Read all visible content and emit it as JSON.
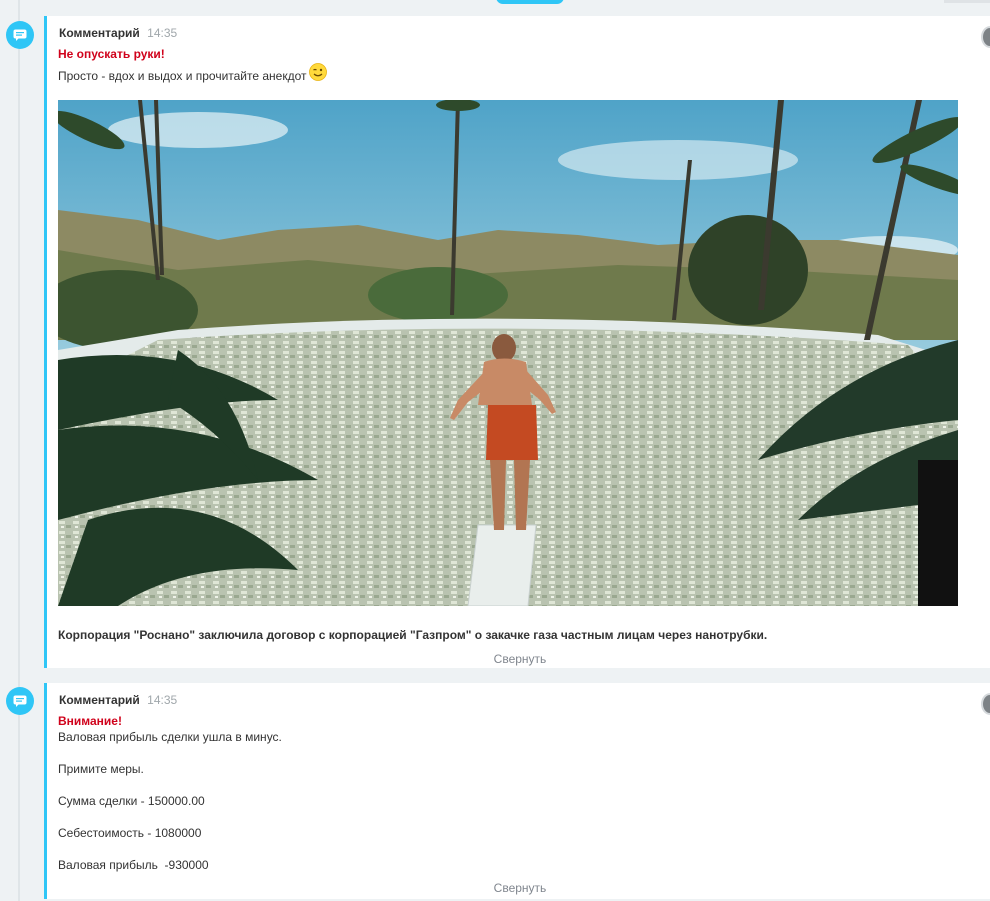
{
  "entries": [
    {
      "title": "Комментарий",
      "time": "14:35",
      "heading": "Не опускать руки!",
      "line": "Просто - вдох и выдох и прочитайте анекдот",
      "emoji": "wink-smiley-icon",
      "photo_icon": "pool-photo-image",
      "caption": "Корпорация \"Роснано\" заключила договор с корпорацией \"Газпром\" о закачке газа частным лицам через нанотрубки.",
      "collapse_label": "Свернуть"
    },
    {
      "title": "Комментарий",
      "time": "14:35",
      "heading": "Внимание!",
      "lines": [
        "Валовая прибыль сделки ушла в минус.",
        "Примите меры.",
        "Сумма сделки - 150000.00",
        "Себестоимость - 1080000",
        "Валовая прибыль  -930000"
      ],
      "collapse_label": "Свернуть"
    }
  ],
  "colors": {
    "accent": "#2fc6f6",
    "alert": "#d0021b",
    "background": "#eef2f4"
  }
}
